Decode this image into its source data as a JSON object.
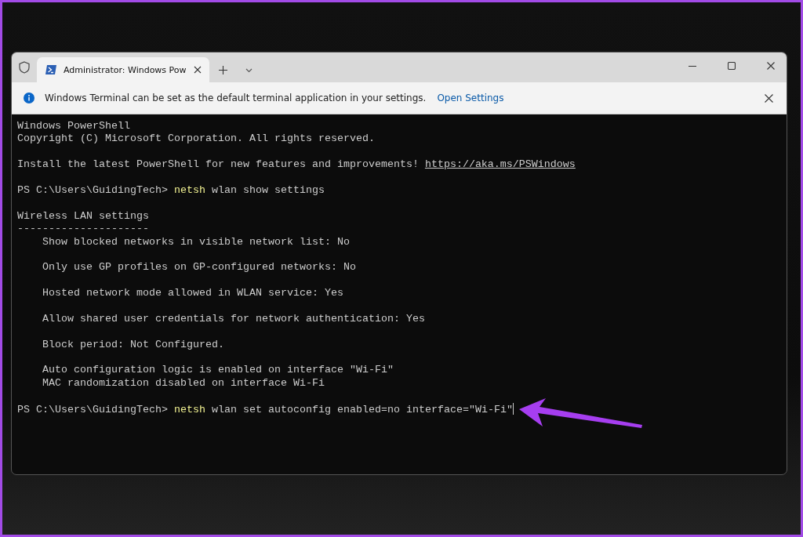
{
  "window": {
    "tabs": [
      {
        "title": "Administrator: Windows Pow",
        "selected": true
      }
    ]
  },
  "infobar": {
    "message": "Windows Terminal can be set as the default terminal application in your settings.",
    "link": "Open Settings"
  },
  "terminal": {
    "blocks": [
      [
        [
          {
            "kind": "plain",
            "text": "Windows PowerShell"
          }
        ],
        [
          {
            "kind": "plain",
            "text": "Copyright (C) Microsoft Corporation. All rights reserved."
          }
        ]
      ],
      [
        [
          {
            "kind": "plain",
            "text": "Install the latest PowerShell for new features and improvements! "
          },
          {
            "kind": "link",
            "text": "https://aka.ms/PSWindows"
          }
        ]
      ],
      [
        [
          {
            "kind": "plain",
            "text": "PS C:\\Users\\GuidingTech> "
          },
          {
            "kind": "command",
            "text": "netsh"
          },
          {
            "kind": "plain",
            "text": " wlan show settings"
          }
        ]
      ],
      [
        [
          {
            "kind": "plain",
            "text": "Wireless LAN settings"
          }
        ],
        [
          {
            "kind": "plain",
            "text": "---------------------"
          }
        ],
        [
          {
            "kind": "plain",
            "text": "    Show blocked networks in visible network list: No"
          }
        ]
      ],
      [
        [
          {
            "kind": "plain",
            "text": "    Only use GP profiles on GP-configured networks: No"
          }
        ]
      ],
      [
        [
          {
            "kind": "plain",
            "text": "    Hosted network mode allowed in WLAN service: Yes"
          }
        ]
      ],
      [
        [
          {
            "kind": "plain",
            "text": "    Allow shared user credentials for network authentication: Yes"
          }
        ]
      ],
      [
        [
          {
            "kind": "plain",
            "text": "    Block period: Not Configured."
          }
        ]
      ],
      [
        [
          {
            "kind": "plain",
            "text": "    Auto configuration logic is enabled on interface \"Wi-Fi\""
          }
        ],
        [
          {
            "kind": "plain",
            "text": "    MAC randomization disabled on interface Wi-Fi"
          }
        ]
      ],
      [
        [
          {
            "kind": "plain",
            "text": "PS C:\\Users\\GuidingTech> "
          },
          {
            "kind": "command",
            "text": "netsh"
          },
          {
            "kind": "plain",
            "text": " wlan set autoconfig enabled=no interface=\"Wi-Fi\""
          }
        ]
      ]
    ],
    "cursor": true
  }
}
